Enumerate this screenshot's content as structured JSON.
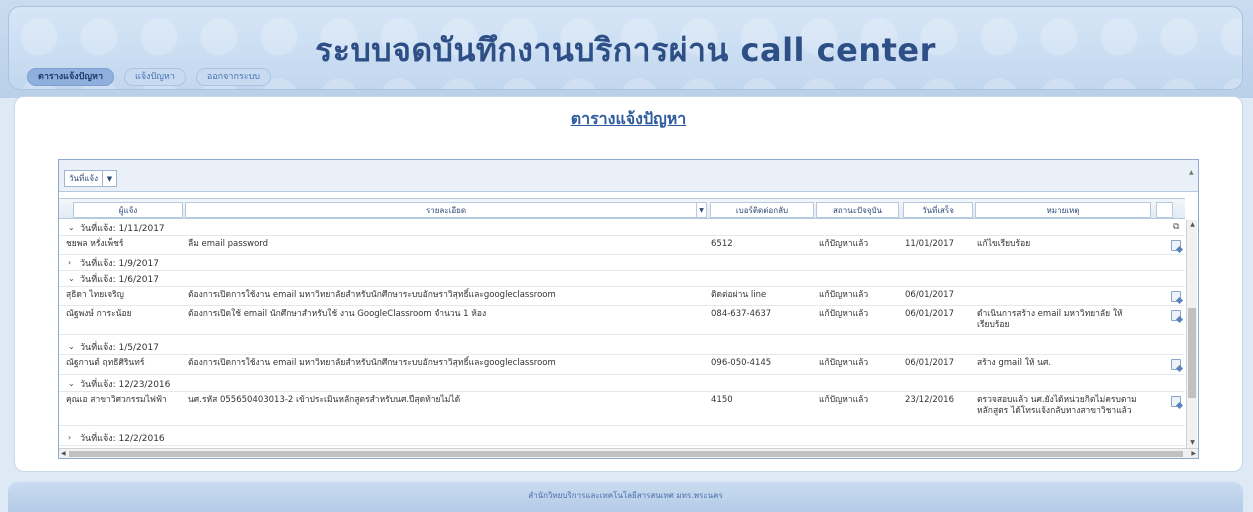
{
  "app": {
    "title": "ระบบจดบันทึกงานบริการผ่าน call center"
  },
  "nav": {
    "items": [
      {
        "label": "ตารางแจ้งปัญหา",
        "active": true
      },
      {
        "label": "แจ้งปัญหา",
        "active": false
      },
      {
        "label": "ออกจากระบบ",
        "active": false
      }
    ]
  },
  "page": {
    "title": "ตารางแจ้งปัญหา"
  },
  "grid": {
    "group_by_label": "วันที่แจ้ง",
    "columns": [
      "ผู้แจ้ง",
      "รายละเอียด",
      "เบอร์ติดต่อกลับ",
      "สถานะปัจจุบัน",
      "วันที่เสร็จ",
      "หมายเหตุ"
    ],
    "groups": [
      {
        "label": "วันที่แจ้ง: 1/11/2017",
        "expanded": true,
        "rows": [
          {
            "reporter": "ชยพล หรั่งเพ็ชร์",
            "detail": "ลืม email password",
            "phone": "6512",
            "status": "แก้ปัญหาแล้ว",
            "done_date": "11/01/2017",
            "note": "แก้ไขเรียบร้อย"
          }
        ]
      },
      {
        "label": "วันที่แจ้ง: 1/9/2017",
        "expanded": false,
        "rows": []
      },
      {
        "label": "วันที่แจ้ง: 1/6/2017",
        "expanded": true,
        "rows": [
          {
            "reporter": "สุธิดา ไทยเจริญ",
            "detail": "ต้องการเปิดการใช้งาน email มหาวิทยาลัยสำหรับนักศึกษาระบบอักษราวิสุทธิ์และgoogleclassroom",
            "phone": "ติดต่อผ่าน line",
            "status": "แก้ปัญหาแล้ว",
            "done_date": "06/01/2017",
            "note": ""
          },
          {
            "reporter": "ณัฐพงษ์ การะน้อย",
            "detail": "ต้องการเปิดใช้ email นักศึกษาสำหรับใช้ งาน GoogleClassroom จำนวน 1 ห้อง",
            "phone": "084-637-4637",
            "status": "แก้ปัญหาแล้ว",
            "done_date": "06/01/2017",
            "note": "ดำเนินการสร้าง email มหาวิทยาลัย ให้เรียบร้อย"
          }
        ]
      },
      {
        "label": "วันที่แจ้ง: 1/5/2017",
        "expanded": true,
        "rows": [
          {
            "reporter": "ณัฐกานต์ ฤทธิศิรินทร์",
            "detail": "ต้องการเปิดการใช้งาน email มหาวิทยาลัยสำหรับนักศึกษาระบบอักษราวิสุทธิ์และgoogleclassroom",
            "phone": "096-050-4145",
            "status": "แก้ปัญหาแล้ว",
            "done_date": "06/01/2017",
            "note": "สร้าง gmail ให้ นศ."
          }
        ]
      },
      {
        "label": "วันที่แจ้ง: 12/23/2016",
        "expanded": true,
        "rows": [
          {
            "reporter": "คุณเอ สาขาวิศวกรรมไฟฟ้า",
            "detail": "นศ.รหัส 055650403013-2 เข้าประเมินหลักสูตรสำหรับนศ.ปีสุดท้ายไม่ได้",
            "phone": "4150",
            "status": "แก้ปัญหาแล้ว",
            "done_date": "23/12/2016",
            "note": "ตรวจสอบแล้ว นศ.ยังได้หน่วยกิตไม่ครบตามหลักสูตร ได้โทรแจ้งกลับทางสาขาวิชาแล้ว"
          }
        ]
      },
      {
        "label": "วันที่แจ้ง: 12/2/2016",
        "expanded": false,
        "rows": []
      }
    ]
  },
  "footer": {
    "text": "สำนักวิทยบริการและเทคโนโลยีสารสนเทศ มทร.พระนคร"
  }
}
